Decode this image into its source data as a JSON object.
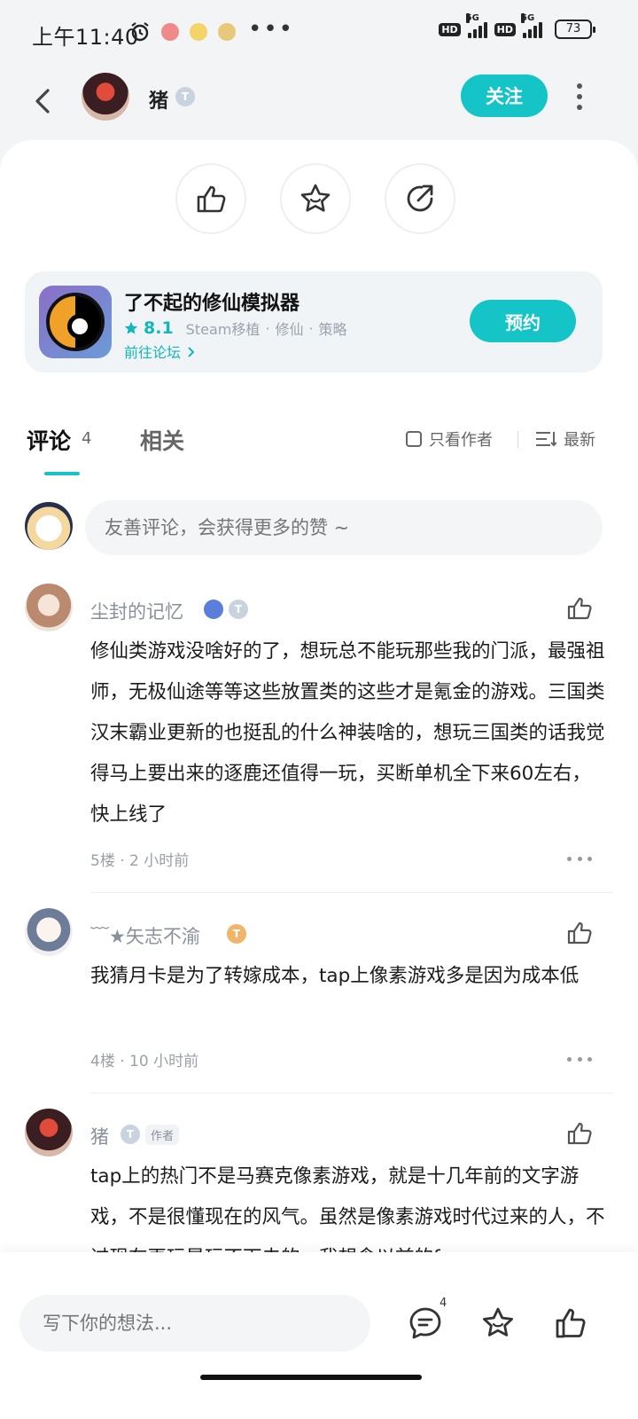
{
  "status": {
    "time": "上午11:40",
    "hd1": "HD",
    "net1": "5G",
    "hd2": "HD",
    "net2": "5G",
    "battery": "73"
  },
  "nav": {
    "user_name": "猪",
    "user_level": "T",
    "follow_label": "关注"
  },
  "game": {
    "title": "了不起的修仙模拟器",
    "score": "8.1",
    "tags": [
      "Steam移植",
      "修仙",
      "策略"
    ],
    "forum_label": "前往论坛",
    "reserve_label": "预约"
  },
  "tabs": {
    "comments_label": "评论",
    "comments_count": "4",
    "related_label": "相关",
    "only_author_label": "只看作者",
    "sort_label": "最新"
  },
  "comment_input_placeholder": "友善评论，会获得更多的赞 ~",
  "comments": [
    {
      "name": "尘封的记忆",
      "level": "T",
      "text": "修仙类游戏没啥好的了，想玩总不能玩那些我的门派，最强祖师，无极仙途等等这些放置类的这些才是氪金的游戏。三国类汉末霸业更新的也挺乱的什么神装啥的，想玩三国类的话我觉得马上要出来的逐鹿还值得一玩，买断单机全下来60左右，快上线了",
      "meta": "5楼 · 2 小时前"
    },
    {
      "name": "﹋★矢志不渝",
      "level": "T",
      "text": "我猜月卡是为了转嫁成本，tap上像素游戏多是因为成本低",
      "meta": "4楼 · 10 小时前"
    },
    {
      "name": "猪",
      "level": "T",
      "author_tag": "作者",
      "text": "tap上的热门不是马赛克像素游戏，就是十几年前的文字游戏，不是很懂现在的风气。虽然是像素游戏时代过来的人，不过现在再玩是玩不下去的。我想念以前的fc"
    }
  ],
  "bottom": {
    "input_placeholder": "写下你的想法...",
    "comment_badge": "4"
  },
  "colors": {
    "accent": "#14c4c6"
  }
}
